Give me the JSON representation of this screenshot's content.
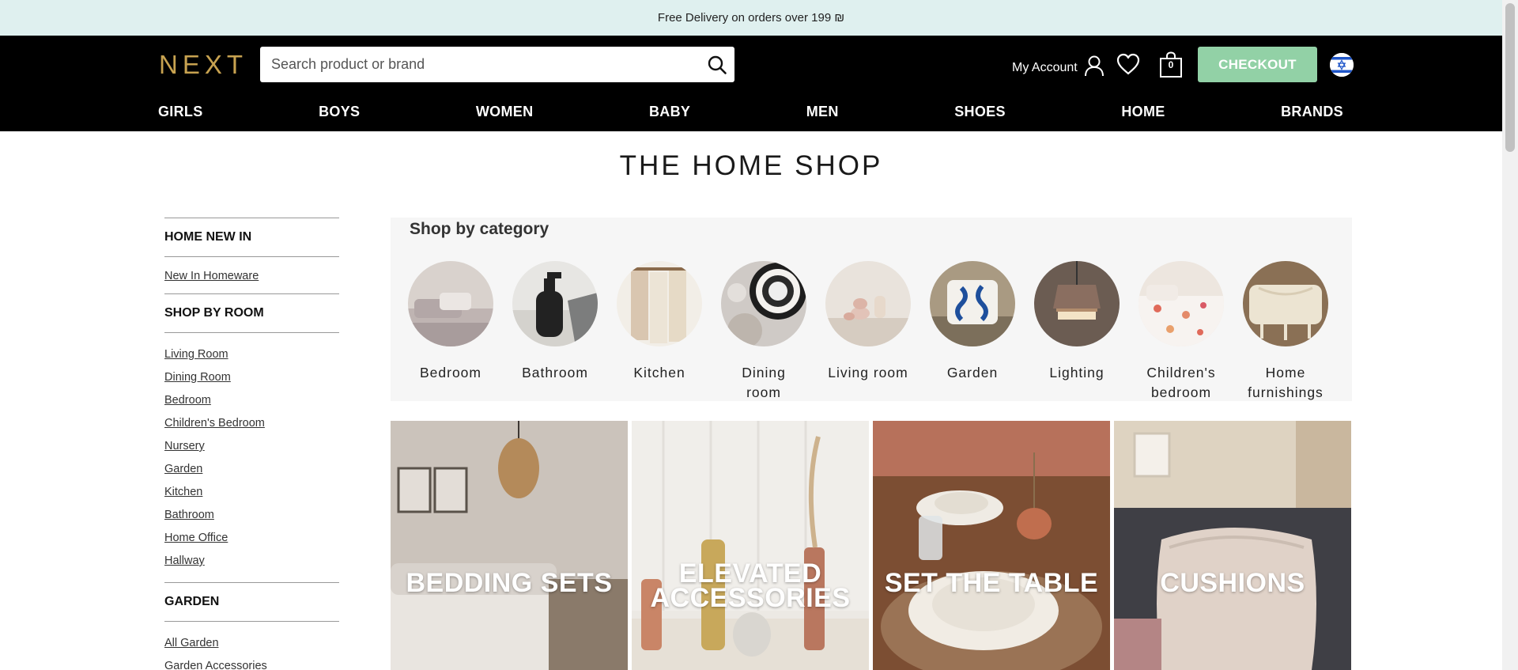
{
  "promo": {
    "text": "Free Delivery on orders over 199 ₪"
  },
  "header": {
    "logo": "NEXT",
    "search_placeholder": "Search product or brand",
    "account_label": "My Account",
    "bag_count": "0",
    "checkout_label": "CHECKOUT"
  },
  "nav": [
    "GIRLS",
    "BOYS",
    "WOMEN",
    "BABY",
    "MEN",
    "SHOES",
    "HOME",
    "BRANDS"
  ],
  "page_title": "THE HOME SHOP",
  "sidebar": {
    "home_new_in": "HOME NEW IN",
    "new_in_links": [
      "New In Homeware"
    ],
    "shop_by_room": "SHOP BY ROOM",
    "room_links": [
      "Living Room",
      "Dining Room",
      "Bedroom",
      "Children's Bedroom",
      "Nursery",
      "Garden",
      "Kitchen",
      "Bathroom",
      "Home Office",
      "Hallway"
    ],
    "garden": "GARDEN",
    "garden_links": [
      "All Garden",
      "Garden Accessories"
    ]
  },
  "shop_by_category": {
    "title": "Shop by category",
    "items": [
      {
        "line1": "Bedroom",
        "line2": ""
      },
      {
        "line1": "Bathroom",
        "line2": ""
      },
      {
        "line1": "Kitchen",
        "line2": ""
      },
      {
        "line1": "Dining",
        "line2": "room"
      },
      {
        "line1": "Living room",
        "line2": ""
      },
      {
        "line1": "Garden",
        "line2": ""
      },
      {
        "line1": "Lighting",
        "line2": ""
      },
      {
        "line1": "Children's",
        "line2": "bedroom"
      },
      {
        "line1": "Home",
        "line2": "furnishings"
      }
    ]
  },
  "tiles": [
    {
      "line1": "BEDDING SETS",
      "line2": ""
    },
    {
      "line1": "ELEVATED",
      "line2": "ACCESSORIES"
    },
    {
      "line1": "SET THE TABLE",
      "line2": ""
    },
    {
      "line1": "CUSHIONS",
      "line2": ""
    }
  ],
  "icons": {
    "search": "search-icon",
    "account": "user-icon",
    "wishlist": "heart-icon",
    "bag": "shopping-bag-icon",
    "flag": "israel-flag-icon"
  },
  "colors": {
    "promo_bg": "#dff0ef",
    "header_bg": "#000000",
    "logo": "#c7a250",
    "checkout_bg": "#92d1a6"
  }
}
